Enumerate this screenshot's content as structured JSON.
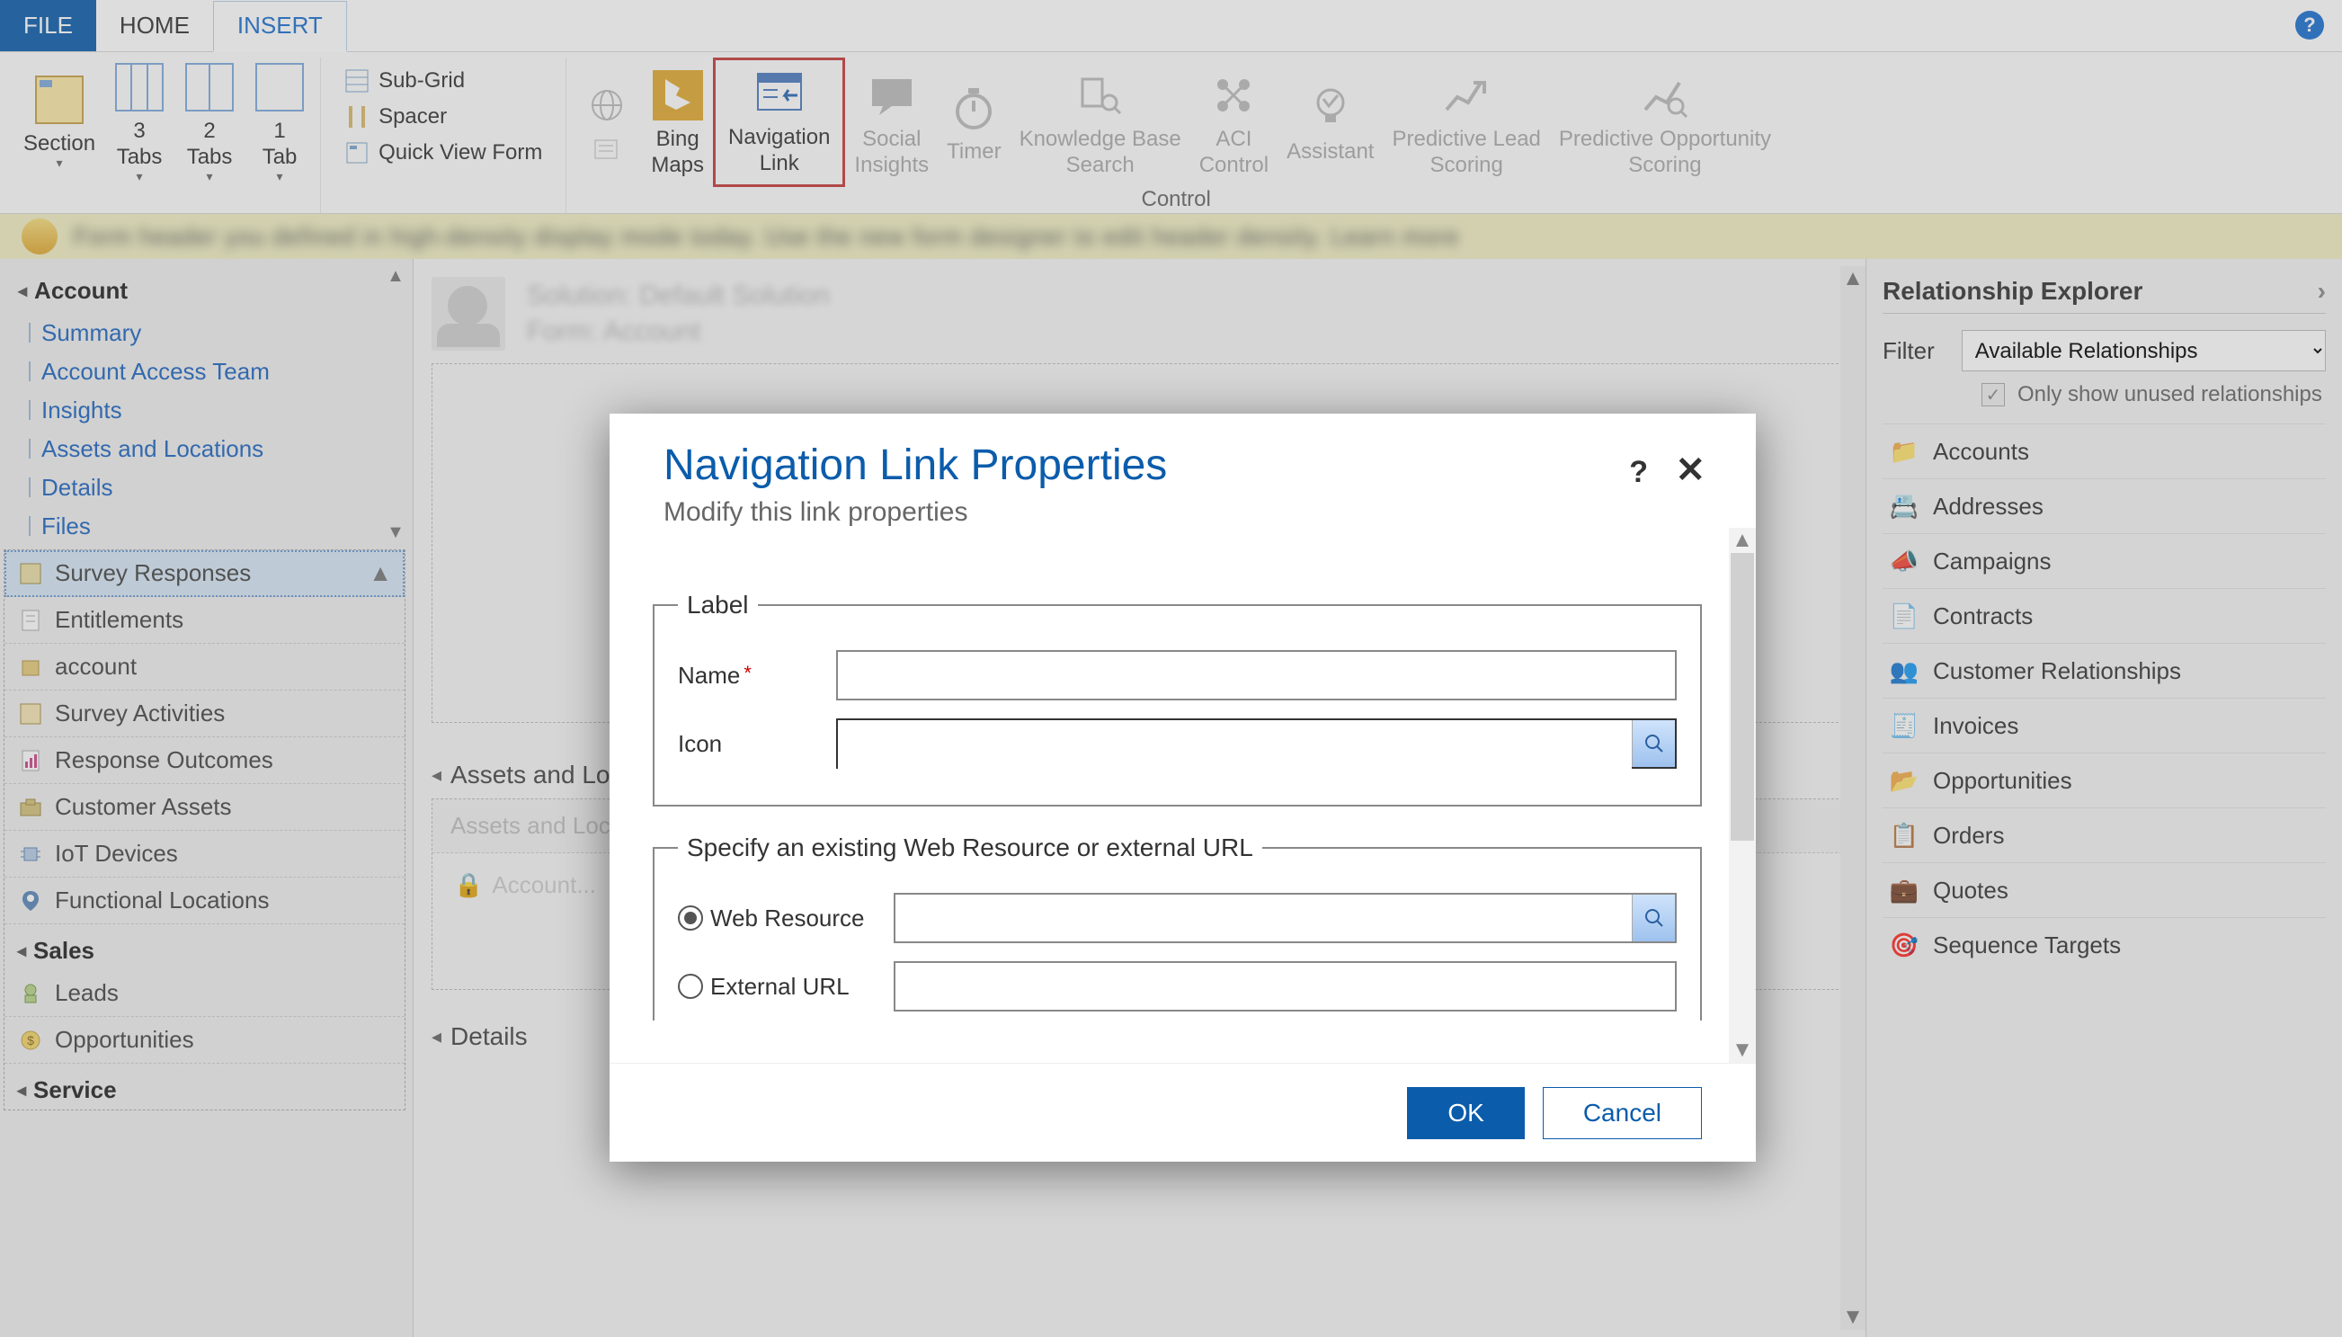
{
  "tabs": {
    "file": "FILE",
    "home": "HOME",
    "insert": "INSERT"
  },
  "ribbon": {
    "section": "Section",
    "tabs3": "3\nTabs",
    "tabs2": "2\nTabs",
    "tab1": "1\nTab",
    "subgrid": "Sub-Grid",
    "spacer": "Spacer",
    "quickview": "Quick View Form",
    "bingmaps": "Bing\nMaps",
    "navlink": "Navigation\nLink",
    "social": "Social\nInsights",
    "timer": "Timer",
    "kbsearch": "Knowledge Base\nSearch",
    "aci": "ACI\nControl",
    "assistant": "Assistant",
    "predlead": "Predictive Lead\nScoring",
    "predopp": "Predictive Opportunity\nScoring",
    "group_control": "Control"
  },
  "sidebar": {
    "title": "Account",
    "links": [
      "Summary",
      "Account Access Team",
      "Insights",
      "Assets and Locations",
      "Details",
      "Files"
    ],
    "nav": [
      {
        "label": "Survey Responses",
        "selected": true
      },
      {
        "label": "Entitlements"
      },
      {
        "label": "account"
      },
      {
        "label": "Survey Activities"
      },
      {
        "label": "Response Outcomes"
      },
      {
        "label": "Customer Assets"
      },
      {
        "label": "IoT Devices"
      },
      {
        "label": "Functional Locations"
      }
    ],
    "sales_head": "Sales",
    "sales": [
      {
        "label": "Leads"
      },
      {
        "label": "Opportunities"
      }
    ],
    "service_head": "Service"
  },
  "center": {
    "solution_prefix": "Solution:",
    "form_prefix": "Form:",
    "assets_title": "Assets and Locations",
    "assets_head": "Assets and Locations",
    "assets_row": "Account...",
    "details_title": "Details"
  },
  "right": {
    "title": "Relationship Explorer",
    "filter_label": "Filter",
    "filter_value": "Available Relationships",
    "only_unused": "Only show unused relationships",
    "items": [
      "Accounts",
      "Addresses",
      "Campaigns",
      "Contracts",
      "Customer Relationships",
      "Invoices",
      "Opportunities",
      "Orders",
      "Quotes",
      "Sequence Targets"
    ]
  },
  "dialog": {
    "title": "Navigation Link Properties",
    "subtitle": "Modify this link properties",
    "label_legend": "Label",
    "name_label": "Name",
    "icon_label": "Icon",
    "spec_legend": "Specify an existing Web Resource or external URL",
    "webres_label": "Web Resource",
    "exturl_label": "External URL",
    "ok": "OK",
    "cancel": "Cancel"
  }
}
